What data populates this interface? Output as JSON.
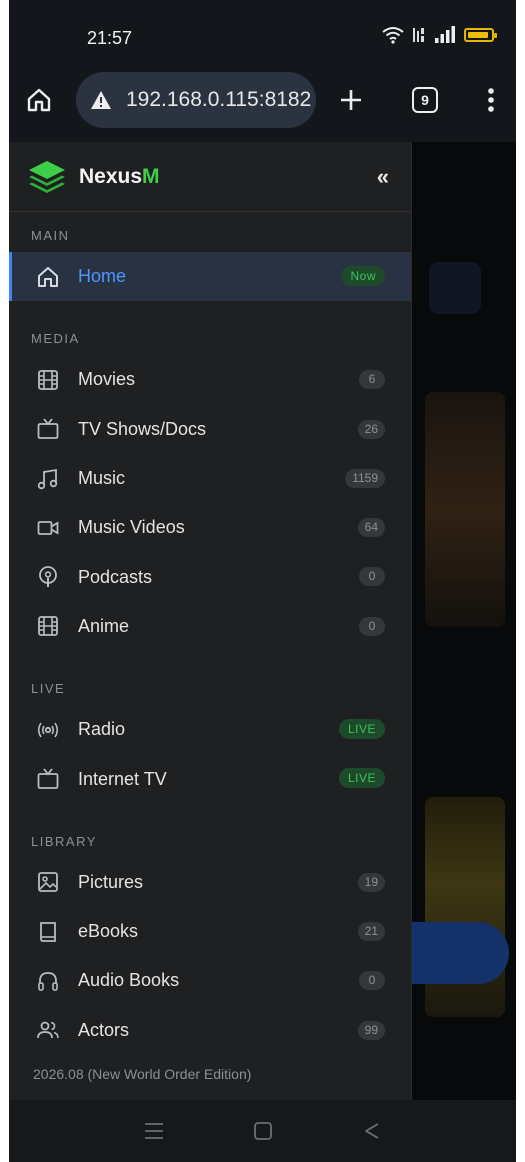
{
  "status_bar": {
    "time": "21:57"
  },
  "browser": {
    "url": "192.168.0.115:8182",
    "tab_count": "9"
  },
  "drawer": {
    "brand_main": "Nexus",
    "brand_accent": "M",
    "collapse_label": "«",
    "sections": {
      "main": "MAIN",
      "media": "MEDIA",
      "live": "LIVE",
      "library": "LIBRARY"
    },
    "home": {
      "label": "Home",
      "tag": "Now"
    },
    "media_items": [
      {
        "label": "Movies",
        "count": "6",
        "icon": "film-icon"
      },
      {
        "label": "TV Shows/Docs",
        "count": "26",
        "icon": "tv-icon"
      },
      {
        "label": "Music",
        "count": "1159",
        "icon": "music-note-icon"
      },
      {
        "label": "Music Videos",
        "count": "64",
        "icon": "video-camera-icon"
      },
      {
        "label": "Podcasts",
        "count": "0",
        "icon": "podcast-icon"
      },
      {
        "label": "Anime",
        "count": "0",
        "icon": "film-icon"
      }
    ],
    "live_items": [
      {
        "label": "Radio",
        "tag": "LIVE",
        "icon": "radio-icon"
      },
      {
        "label": "Internet TV",
        "tag": "LIVE",
        "icon": "tv-icon"
      }
    ],
    "library_items": [
      {
        "label": "Pictures",
        "count": "19",
        "icon": "picture-icon"
      },
      {
        "label": "eBooks",
        "count": "21",
        "icon": "book-icon"
      },
      {
        "label": "Audio Books",
        "count": "0",
        "icon": "headphones-icon"
      },
      {
        "label": "Actors",
        "count": "99",
        "icon": "people-icon"
      }
    ],
    "version": "2026.08 (New World Order Edition)"
  },
  "colors": {
    "accent": "#3f86f7",
    "brand_green": "#3ecf4a",
    "live_green": "#40c15a"
  }
}
